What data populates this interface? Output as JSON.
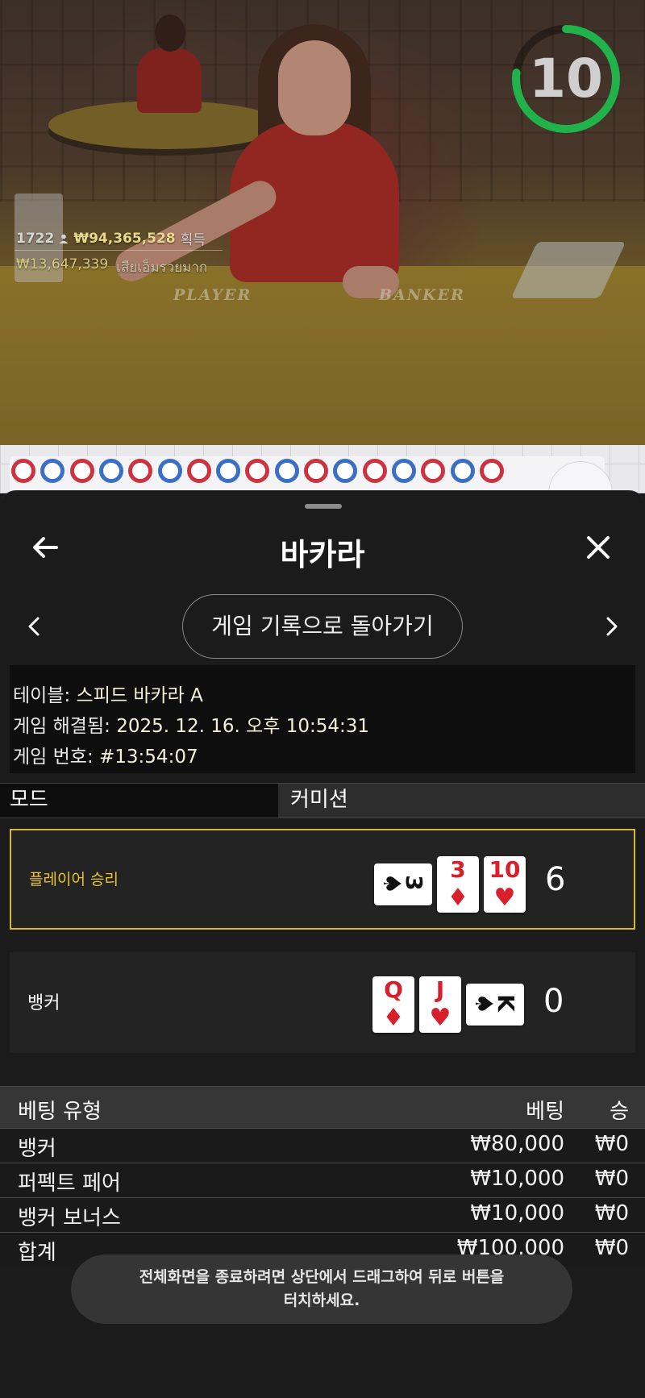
{
  "video": {
    "timer_value": "10",
    "winners_count": "1722",
    "winners_amount": "₩94,365,528",
    "winners_suffix": "획득",
    "losers_amount": "₩13,647,339",
    "losers_suffix": "เสียเอ็มรวยมาก",
    "felt_player": "PLAYER",
    "felt_banker": "BANKER",
    "colors": {
      "timer_ring": "#22b24c",
      "gold_text": "#e8d88a"
    }
  },
  "road": {
    "row1": [
      "red",
      "blue",
      "red",
      "blue",
      "red",
      "blue",
      "red",
      "blue",
      "red",
      "blue",
      "red",
      "blue",
      "red",
      "blue",
      "red",
      "blue",
      "red"
    ],
    "colors": {
      "red": "#cc3340",
      "blue": "#3b6fc4"
    }
  },
  "sheet": {
    "title": "바카라",
    "return_label": "게임 기록으로 돌아가기",
    "meta": {
      "table_label": "테이블:",
      "table_value": "스피드 바카라 A",
      "resolved_label": "게임 해결됨:",
      "resolved_value": "2025. 12. 16. 오후 10:54:31",
      "game_no_label": "게임 번호:",
      "game_no_value": "#13:54:07"
    },
    "mode": {
      "label": "모드",
      "value": "커미션"
    },
    "player": {
      "label": "플레이어 승리",
      "score": "6",
      "cards": [
        {
          "rank": "3",
          "suit": "♠",
          "color": "black",
          "side": true
        },
        {
          "rank": "3",
          "suit": "♦",
          "color": "red"
        },
        {
          "rank": "10",
          "suit": "♥",
          "color": "red"
        }
      ]
    },
    "banker": {
      "label": "뱅커",
      "score": "0",
      "cards": [
        {
          "rank": "Q",
          "suit": "♦",
          "color": "red"
        },
        {
          "rank": "J",
          "suit": "♥",
          "color": "red"
        },
        {
          "rank": "K",
          "suit": "♠",
          "color": "black",
          "side": true
        }
      ]
    },
    "bets": {
      "headers": {
        "type": "베팅 유형",
        "bet": "베팅",
        "win": "승"
      },
      "rows": [
        {
          "type": "뱅커",
          "bet": "₩80,000",
          "win": "₩0"
        },
        {
          "type": "퍼펙트 페어",
          "bet": "₩10,000",
          "win": "₩0"
        },
        {
          "type": "뱅커 보너스",
          "bet": "₩10,000",
          "win": "₩0"
        },
        {
          "type": "합계",
          "bet": "₩100,000",
          "win": "₩0"
        }
      ]
    },
    "colors": {
      "player_highlight": "#d9b634",
      "red_card": "#d8202c"
    }
  },
  "toast": {
    "line1": "전체화면을 종료하려면 상단에서 드래그하여 뒤로 버튼을",
    "line2": "터치하세요."
  }
}
